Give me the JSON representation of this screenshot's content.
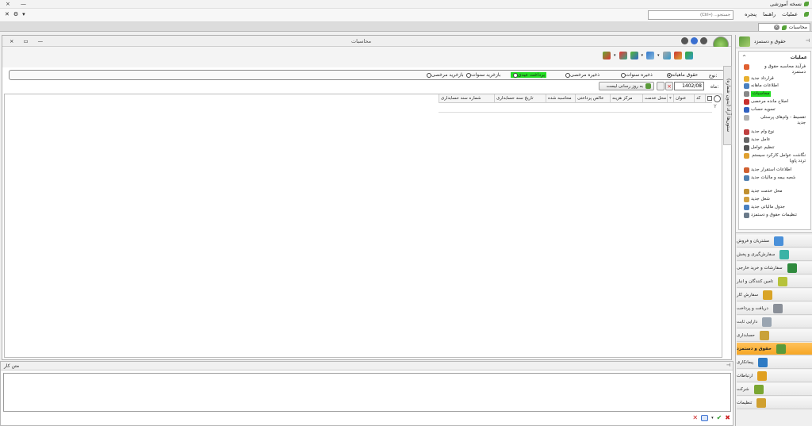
{
  "window": {
    "title": "نسخه آموزشی",
    "controls": [
      "×",
      "—"
    ]
  },
  "menu": {
    "items": [
      "عملیات",
      "راهنما",
      "پنجره"
    ],
    "left_controls": [
      "✕",
      "⚙",
      "▾"
    ]
  },
  "search": {
    "placeholder": "جستجو... (Ctrl+‎)"
  },
  "doc_tab": {
    "label": "محاسبات"
  },
  "main": {
    "title": "محاسبات",
    "filter": {
      "type_label": "نوع:",
      "options": [
        {
          "label": "حقوق ماهیانه",
          "selected": true,
          "highlight": false
        },
        {
          "label": "ذخیره سنوات",
          "selected": false,
          "highlight": false
        },
        {
          "label": "ذخیره مرخصی",
          "selected": false,
          "highlight": false
        },
        {
          "label": "پرداخت عیدی",
          "selected": false,
          "highlight": true
        },
        {
          "label": "بازخرید سنوات",
          "selected": false,
          "highlight": false
        },
        {
          "label": "بازخرید مرخصی",
          "selected": false,
          "highlight": false
        }
      ],
      "month_label": "ماه:",
      "month_value": "1402/08",
      "refresh_label": "به روز رسانی لیست"
    },
    "side_tab_label": "ستون‌ها آزاد (بدون شماره)",
    "grid": {
      "columns": [
        "کد",
        "عنوان",
        "محل خدمت",
        "مرکز هزینه",
        "خالص پرداختی",
        "محاسبه شده",
        "تاریخ سند حسابداری",
        "شماره سند حسابداری"
      ]
    }
  },
  "notes": {
    "title": "متن کار"
  },
  "right_panel": {
    "title": "حقوق و دستمزد",
    "ops_title": "عملیات",
    "operations": [
      "فرآیند محاسبه حقوق و دستمزد",
      "قرارداد جدید",
      "اطلاعات ماهانه",
      "محاسبات",
      "اصلاح مانده مرخصی",
      "تسویه حساب",
      "تقسیط - وام‌های پرسنلی جدید",
      "نوع وام جدید",
      "عامل جدید",
      "تنظیم عوامل",
      "نگاشت عوامل کارکرد سیستم تردد پاویا",
      "اطلاعات استقرار جدید",
      "شعبه بیمه و مالیات جدید",
      "محل خدمت جدید",
      "شغل جدید",
      "جدول مالیاتی جدید",
      "تنظیمات حقوق و دستمزد"
    ],
    "highlight_op": "محاسبات",
    "modules": [
      {
        "label": "مشتریان و فروش",
        "color": "#4a90d9",
        "active": false
      },
      {
        "label": "سفارش‌گیری و پخش",
        "color": "#3bb3a6",
        "active": false
      },
      {
        "label": "سفارشات و خرید خارجی",
        "color": "#2f8a3d",
        "active": false
      },
      {
        "label": "تامین کنندگان و انبار",
        "color": "#b6c23a",
        "active": false
      },
      {
        "label": "سفارش کار",
        "color": "#d9a427",
        "active": false
      },
      {
        "label": "دریافت و پرداخت",
        "color": "#8a8f98",
        "active": false
      },
      {
        "label": "دارایی ثابت",
        "color": "#9aa5b1",
        "active": false
      },
      {
        "label": "حسابداری",
        "color": "#c9a23a",
        "active": false
      },
      {
        "label": "حقوق و دستمزد",
        "color": "#5a9a3a",
        "active": true
      },
      {
        "label": "پیمانکاری",
        "color": "#2e7bc4",
        "active": false
      },
      {
        "label": "ارتباطات",
        "color": "#e0a020",
        "active": false
      },
      {
        "label": "شرکت",
        "color": "#7aa632",
        "active": false
      },
      {
        "label": "تنظیمات",
        "color": "#d0a030",
        "active": false
      }
    ]
  },
  "colors": {
    "highlight": "#22dd22",
    "active_module": "#f6a623"
  }
}
